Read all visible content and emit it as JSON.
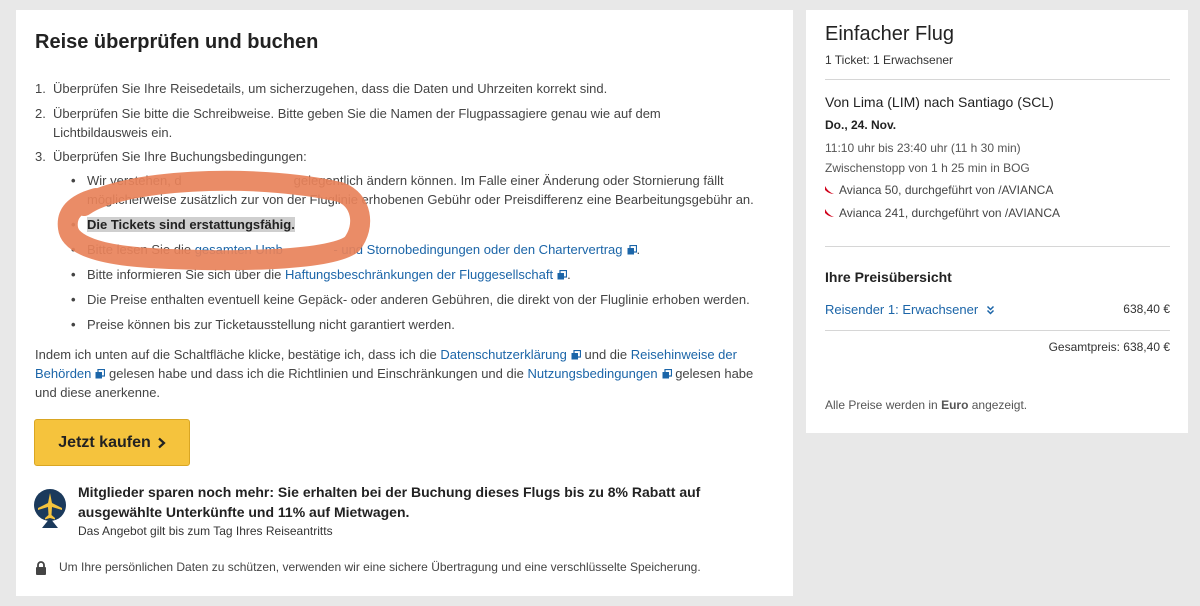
{
  "review": {
    "title": "Reise überprüfen und buchen",
    "steps": [
      {
        "num": "1.",
        "text": "Überprüfen Sie Ihre Reisedetails, um sicherzugehen, dass die Daten und Uhrzeiten korrekt sind."
      },
      {
        "num": "2.",
        "line1": "Überprüfen Sie bitte die Schreibweise. Bitte geben Sie die Namen der Flugpassagiere genau wie auf dem",
        "line2": "Lichtbildausweis ein."
      },
      {
        "num": "3.",
        "text": "Überprüfen Sie Ihre Buchungsbedingungen:"
      }
    ],
    "bullets": {
      "b1_line1": "Wir verstehen, d                               gelegentlich ändern können. Im Falle einer Änderung oder Stornierung fällt",
      "b1_line2": "möglicherweise zusätzlich zur von der Fluglinie erhobenen Gebühr oder Preisdifferenz eine Bearbeitungsgebühr an.",
      "b2": "Die Tickets sind erstattungsfähig.",
      "b3_pre": "Bitte lesen Sie die ",
      "b3_link": "gesamten Umb              - und Stornobedingungen oder den Chartervertrag",
      "b3_post": ".",
      "b4_pre": "Bitte informieren Sie sich über die ",
      "b4_link": "Haftungsbeschränkungen der Fluggesellschaft",
      "b4_post": ".",
      "b5": "Die Preise enthalten eventuell keine Gepäck- oder anderen Gebühren, die direkt von der Fluglinie erhoben werden.",
      "b6": "Preise können bis zur Ticketausstellung nicht garantiert werden."
    },
    "confirm": {
      "t1": "Indem ich unten auf die Schaltfläche klicke, bestätige ich, dass ich die ",
      "l1": "Datenschutzerklärung",
      "t2": " und die ",
      "l2": "Reisehinweise der Behörden",
      "t3": " gelesen habe und dass ich die Richtlinien und Einschränkungen und die ",
      "l3": "Nutzungsbedingungen",
      "t4": " gelesen habe und diese anerkenne."
    },
    "buy_button": "Jetzt kaufen",
    "promo": {
      "headline": "Mitglieder sparen noch mehr: Sie erhalten bei der Buchung dieses Flugs bis zu 8% Rabatt auf ausgewählte Unterkünfte und 11% auf Mietwagen.",
      "sub": "Das Angebot gilt bis zum Tag Ihres Reiseantritts"
    },
    "security": "Um Ihre persönlichen Daten zu schützen, verwenden wir eine sichere Übertragung und eine verschlüsselte Speicherung."
  },
  "summary": {
    "flight_type": "Einfacher Flug",
    "tickets": "1 Ticket: 1 Erwachsener",
    "route": "Von Lima (LIM) nach Santiago (SCL)",
    "date": "Do., 24. Nov.",
    "times": "11:10 uhr bis 23:40 uhr (11 h 30 min)",
    "stopover": "Zwischenstopp von 1 h 25 min in BOG",
    "carriers": [
      "Avianca 50, durchgeführt von /AVIANCA",
      "Avianca 241, durchgeführt von /AVIANCA"
    ],
    "price_title": "Ihre Preisübersicht",
    "traveler": "Reisender 1: Erwachsener",
    "traveler_price": "638,40 €",
    "total": "Gesamtpreis: 638,40 €",
    "currency_pre": "Alle Preise werden in ",
    "currency_bold": "Euro",
    "currency_post": " angezeigt."
  },
  "colors": {
    "link": "#1b65a8",
    "button": "#f5c33d",
    "scribble": "#e8825a",
    "airline": "#d0021b"
  },
  "icons": {
    "external": "external-link-icon",
    "chevron": "chevron-right-icon",
    "expand": "double-chevron-down-icon",
    "lock": "lock-icon",
    "promo": "airplane-badge-icon",
    "airline": "airline-logo-icon"
  }
}
